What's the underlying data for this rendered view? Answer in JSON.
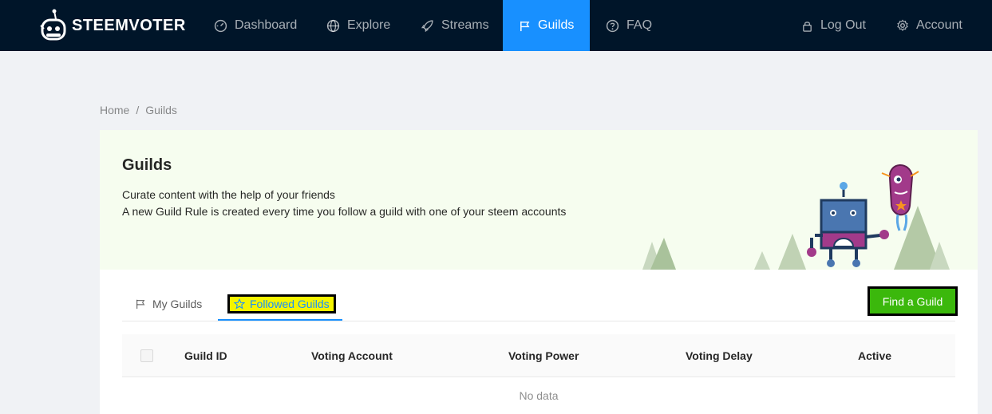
{
  "nav": {
    "brand": "STEEMVOTER",
    "items": [
      {
        "label": "Dashboard",
        "icon": "dashboard-icon"
      },
      {
        "label": "Explore",
        "icon": "globe-icon"
      },
      {
        "label": "Streams",
        "icon": "rocket-icon"
      },
      {
        "label": "Guilds",
        "icon": "flag-icon",
        "active": true
      },
      {
        "label": "FAQ",
        "icon": "question-circle-icon"
      }
    ],
    "logout": "Log Out",
    "account": "Account"
  },
  "breadcrumb": {
    "home": "Home",
    "separator": "/",
    "current": "Guilds"
  },
  "hero": {
    "title": "Guilds",
    "line1": "Curate content with the help of your friends",
    "line2": "A new Guild Rule is created every time you follow a guild with one of your steem accounts"
  },
  "tabs": {
    "my_guilds": "My Guilds",
    "followed_guilds": "Followed Guilds"
  },
  "find_button": "Find a Guild",
  "table": {
    "columns": [
      "Guild ID",
      "Voting Account",
      "Voting Power",
      "Voting Delay",
      "Active"
    ],
    "empty_text": "No data"
  },
  "colors": {
    "nav_bg": "#001529",
    "accent": "#1890ff",
    "hero_bg": "#f6fdef",
    "find_button_bg": "#3bb80c",
    "tab_highlight": "#f5f500"
  }
}
